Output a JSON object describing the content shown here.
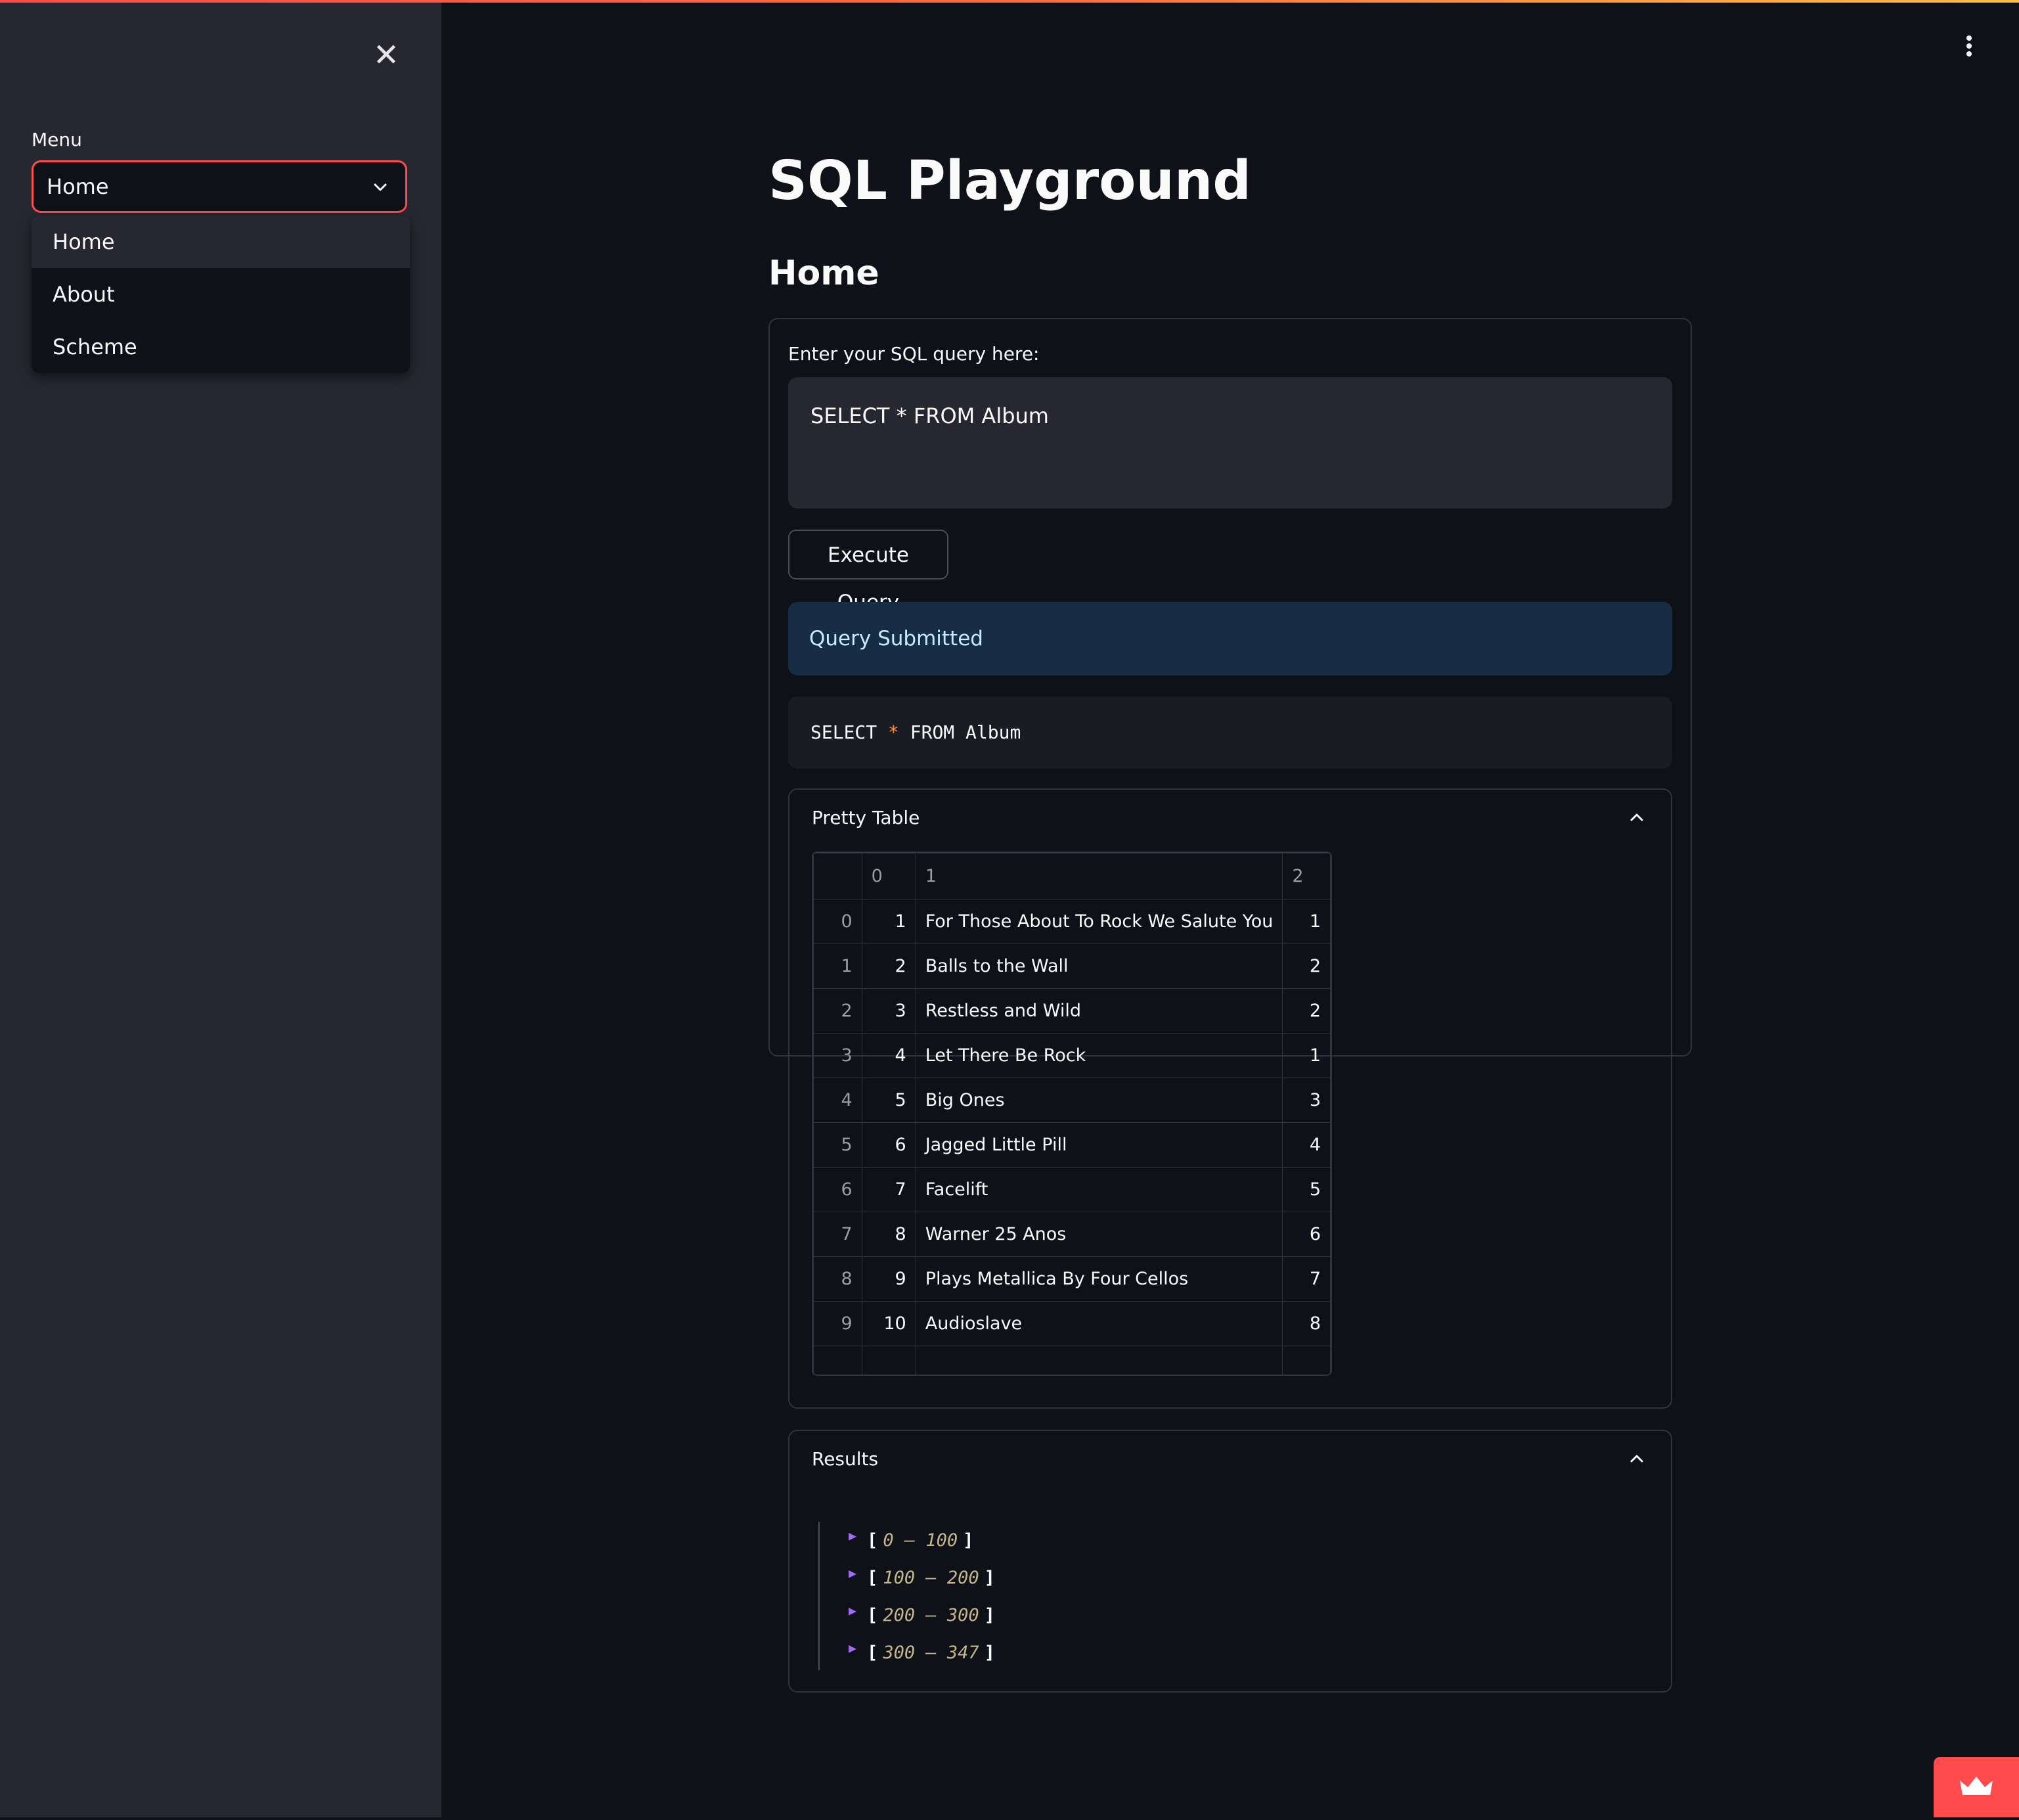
{
  "sidebar": {
    "menu_label": "Menu",
    "select_value": "Home",
    "options": [
      "Home",
      "About",
      "Scheme"
    ]
  },
  "main": {
    "title": "SQL Playground",
    "subtitle": "Home",
    "query_label": "Enter your SQL query here:",
    "query_value": "SELECT * FROM Album",
    "execute_label": "Execute Query",
    "status": "Query Submitted",
    "code": {
      "pre": "SELECT ",
      "star": "*",
      "post": " FROM Album"
    }
  },
  "table": {
    "title": "Pretty Table",
    "columns": [
      "0",
      "1",
      "2"
    ],
    "rows": [
      [
        "0",
        "1",
        "For Those About To Rock We Salute You",
        "1"
      ],
      [
        "1",
        "2",
        "Balls to the Wall",
        "2"
      ],
      [
        "2",
        "3",
        "Restless and Wild",
        "2"
      ],
      [
        "3",
        "4",
        "Let There Be Rock",
        "1"
      ],
      [
        "4",
        "5",
        "Big Ones",
        "3"
      ],
      [
        "5",
        "6",
        "Jagged Little Pill",
        "4"
      ],
      [
        "6",
        "7",
        "Facelift",
        "5"
      ],
      [
        "7",
        "8",
        "Warner 25 Anos",
        "6"
      ],
      [
        "8",
        "9",
        "Plays Metallica By Four Cellos",
        "7"
      ],
      [
        "9",
        "10",
        "Audioslave",
        "8"
      ]
    ]
  },
  "results": {
    "title": "Results",
    "ranges": [
      {
        "start": "0",
        "end": "100"
      },
      {
        "start": "100",
        "end": "200"
      },
      {
        "start": "200",
        "end": "300"
      },
      {
        "start": "300",
        "end": "347"
      }
    ]
  },
  "icons": {
    "close": "close-icon",
    "menu": "kebab-menu-icon",
    "chevron": "chevron-down-icon",
    "collapse": "chevron-up-icon",
    "badge": "crown-icon"
  },
  "colors": {
    "accent": "#ff4b4b",
    "background": "#0e1117",
    "sidebar": "#262730",
    "info": "#172d43",
    "json_caret": "#a66bf5"
  }
}
